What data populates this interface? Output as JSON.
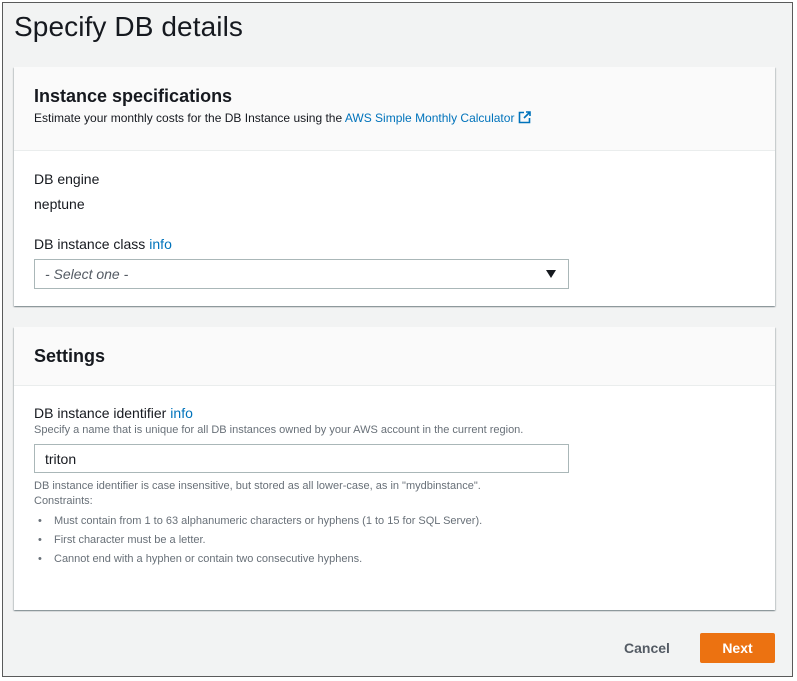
{
  "page": {
    "title": "Specify DB details"
  },
  "instance_specs": {
    "title": "Instance specifications",
    "description_prefix": "Estimate your monthly costs for the DB Instance using the ",
    "calculator_link": "AWS Simple Monthly Calculator",
    "db_engine_label": "DB engine",
    "db_engine_value": "neptune",
    "instance_class_label": "DB instance class",
    "instance_class_info": "info",
    "instance_class_selected": "- Select one -"
  },
  "settings": {
    "title": "Settings",
    "identifier_label": "DB instance identifier",
    "identifier_info": "info",
    "identifier_help": "Specify a name that is unique for all DB instances owned by your AWS account in the current region.",
    "identifier_value": "triton",
    "identifier_note": "DB instance identifier is case insensitive, but stored as all lower-case, as in \"mydbinstance\".",
    "constraints_label": "Constraints:",
    "constraints": [
      "Must contain from 1 to 63 alphanumeric characters or hyphens (1 to 15 for SQL Server).",
      "First character must be a letter.",
      "Cannot end with a hyphen or contain two consecutive hyphens."
    ]
  },
  "actions": {
    "cancel_label": "Cancel",
    "next_label": "Next"
  },
  "colors": {
    "primary_button": "#ec7211",
    "link": "#0073bb",
    "background": "#f2f3f3"
  },
  "icons": {
    "external_link": "external-link-icon",
    "dropdown": "caret-down-icon"
  }
}
